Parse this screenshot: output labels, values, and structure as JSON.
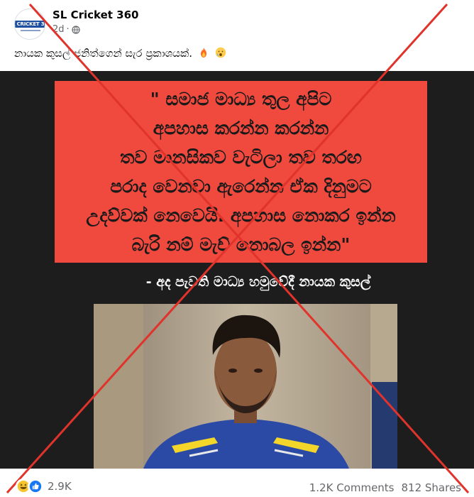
{
  "post": {
    "page_name": "SL Cricket 360",
    "avatar_text": "SL CRICKET 360",
    "time": "2d",
    "time_separator": "·",
    "caption": "නායක කුසල් ජනිත්ගෙන් සැර ප්‍රකාශයක්."
  },
  "image": {
    "quote_lines": [
      "\" සමාජ මාධ්‍ය තුල අපිට",
      "අපහාස කරන්න කරන්න",
      "තව මානසිකව වැටිලා තව තරඟ",
      "පරාද වෙනවා ඇරෙන්න ඒක දිනුමට",
      "උදව්වක් නෙවෙයි. අපහාස නොකර ඉන්න",
      "බැරි නම් මැච් නොබල ඉන්න\""
    ],
    "attribution": "- අද පැවති මාධ්‍ය හමුවේදී නායක කුසල්"
  },
  "footer": {
    "reaction_count": "2.9K",
    "comments": "1.2K Comments",
    "shares": "812 Shares"
  },
  "icons": {
    "globe": "globe-icon",
    "fire": "fire-emoji-icon",
    "surprised": "surprised-emoji-icon",
    "haha": "haha-reaction-icon",
    "like": "like-reaction-icon"
  },
  "colors": {
    "quote_background": "#f0493d",
    "image_background": "#1d1d1d",
    "overlay_x": "#e0332b",
    "meta_text": "#65676b"
  }
}
